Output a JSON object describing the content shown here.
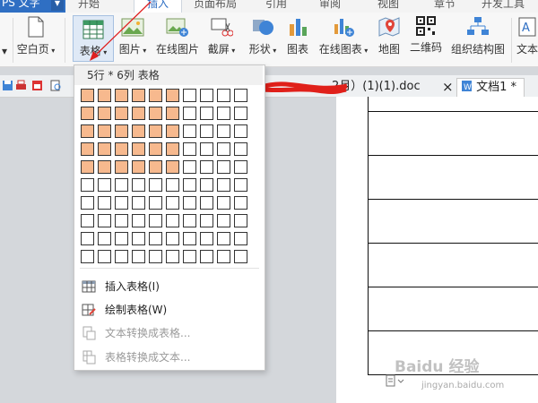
{
  "app": {
    "name": "PS 文字"
  },
  "ribbon_tabs": [
    "开始",
    "插入",
    "页面布局",
    "引用",
    "审阅",
    "视图",
    "章节",
    "开发工具"
  ],
  "ribbon_items": {
    "blank_page": "空白页",
    "table": "表格",
    "image": "图片",
    "online_image": "在线图片",
    "screenshot": "截屏",
    "shape": "形状",
    "chart": "图表",
    "online_chart": "在线图表",
    "map": "地图",
    "qrcode": "二维码",
    "org_chart": "组织结构图",
    "text": "文本"
  },
  "doc_tabs": {
    "first": "2月）(1)(1).doc",
    "second": "文档1 *",
    "close": "×"
  },
  "dropdown": {
    "title": "5行 * 6列 表格",
    "grid": {
      "rows": 10,
      "cols": 10,
      "selected_rows": 5,
      "selected_cols": 6
    },
    "items": [
      {
        "label": "插入表格(I)",
        "enabled": true
      },
      {
        "label": "绘制表格(W)",
        "enabled": true
      },
      {
        "label": "文本转换成表格...",
        "enabled": false
      },
      {
        "label": "表格转换成文本...",
        "enabled": false
      }
    ]
  },
  "watermark": {
    "main": "Baidu 经验",
    "sub": "jingyan.baidu.com"
  },
  "colors": {
    "accent": "#2f6fc3",
    "selection": "#f7b98e",
    "arrow": "#e02020"
  }
}
